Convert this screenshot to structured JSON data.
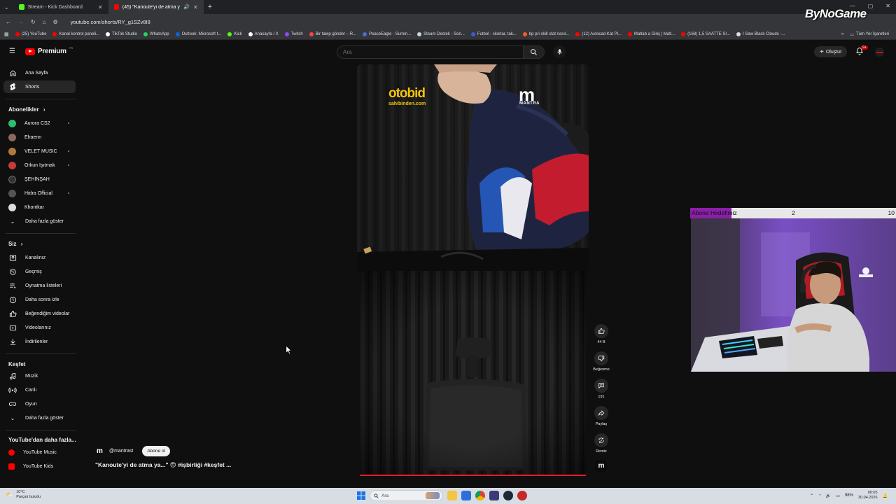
{
  "browser": {
    "tabs": [
      {
        "title": "Stream - Kick Dashboard",
        "active": false,
        "favicon_color": "#53fc18"
      },
      {
        "title": "(45) \"Kanoute'yi de atma ya...",
        "active": true,
        "favicon_color": "#ff0000"
      }
    ],
    "url": "youtube.com/shorts/RY_g1SZv8I8",
    "bookmarks": [
      {
        "label": "(25) YouTube",
        "color": "#ff0000"
      },
      {
        "label": "Kanal kontrol paneli...",
        "color": "#ff0000"
      },
      {
        "label": "TikTok Studio",
        "color": "#ffffff"
      },
      {
        "label": "WhatsApp",
        "color": "#25d366"
      },
      {
        "label": "Outlook: Microsoft t...",
        "color": "#0a64d6"
      },
      {
        "label": "Kick",
        "color": "#53fc18"
      },
      {
        "label": "Anasayfa / X",
        "color": "#ffffff"
      },
      {
        "label": "Twitch",
        "color": "#9146ff"
      },
      {
        "label": "Bir talep gönder – R...",
        "color": "#ff4444"
      },
      {
        "label": "PeaceEagle - Summ...",
        "color": "#4a6cd4"
      },
      {
        "label": "Steam Destek - Son...",
        "color": "#c7d5e0"
      },
      {
        "label": "Futbol - skorlar, tak...",
        "color": "#3a5bd9"
      },
      {
        "label": "bp pri skill stat nasıl...",
        "color": "#ff5722"
      },
      {
        "label": "(12) Autocad Kat Pl...",
        "color": "#ff0000"
      },
      {
        "label": "Matlab a Giriş | Matl...",
        "color": "#ff0000"
      },
      {
        "label": "(168) 1,5 SAATTE SI...",
        "color": "#ff0000"
      },
      {
        "label": "I Saw Black Clouds -...",
        "color": "#dddddd"
      }
    ],
    "all_bookmarks": "Tüm Yer İşaretleri"
  },
  "watermark": "ByNoGame",
  "header": {
    "logo_text": "Premium",
    "logo_sup": "TR",
    "search_placeholder": "Ara",
    "create_label": "Oluştur",
    "notif_badge": "9+"
  },
  "sidebar": {
    "main": [
      {
        "label": "Ana Sayfa",
        "icon": "home-icon"
      },
      {
        "label": "Shorts",
        "icon": "shorts-icon",
        "active": true
      }
    ],
    "subscriptions_header": "Abonelikler",
    "subscriptions": [
      {
        "label": "Aurora CS2",
        "color": "#2dbd6e",
        "dot": true
      },
      {
        "label": "Elraenn",
        "color": "#8a6a5a",
        "dot": false
      },
      {
        "label": "VELET MUSIC",
        "color": "#b07a3a",
        "dot": true
      },
      {
        "label": "Orkun Işıtmak",
        "color": "#c43c3c",
        "dot": true
      },
      {
        "label": "ŞEHİNŞAH",
        "color": "#333333",
        "dot": false
      },
      {
        "label": "Hidra Official",
        "color": "#555555",
        "dot": true
      },
      {
        "label": "Khontkar",
        "color": "#dddddd",
        "dot": false
      }
    ],
    "show_more": "Daha fazla göster",
    "you_header": "Siz",
    "you": [
      {
        "label": "Kanalınız",
        "icon": "channel-icon"
      },
      {
        "label": "Geçmiş",
        "icon": "history-icon"
      },
      {
        "label": "Oynatma listeleri",
        "icon": "playlist-icon"
      },
      {
        "label": "Daha sonra izle",
        "icon": "clock-icon"
      },
      {
        "label": "Beğendiğim videolar",
        "icon": "like-icon"
      },
      {
        "label": "Videolarınız",
        "icon": "video-icon"
      },
      {
        "label": "İndirilenler",
        "icon": "download-icon"
      }
    ],
    "explore_header": "Keşfet",
    "explore": [
      {
        "label": "Müzik",
        "icon": "music-icon"
      },
      {
        "label": "Canlı",
        "icon": "live-icon"
      },
      {
        "label": "Oyun",
        "icon": "gaming-icon"
      }
    ],
    "explore_more": "Daha fazla göster",
    "more_header": "YouTube'dan daha fazla...",
    "more": [
      {
        "label": "YouTube Music"
      },
      {
        "label": "YouTube Kids"
      }
    ]
  },
  "short": {
    "sponsor_logo": "otobid",
    "sponsor_sub": "sahibinden.com",
    "brand_logo": "m",
    "brand_text": "MANTRA",
    "channel_logo": "m",
    "channel_name": "@mantrast",
    "subscribe_label": "Abone ol",
    "title": "\"Kanoute'yi de atma ya...\" 😍 #işbirliği #keşfet ...",
    "progress": 1.0,
    "actions": {
      "likes": "44 B",
      "dislike_label": "Beğenme",
      "comments": "191",
      "share_label": "Paylaş",
      "remix_label": "Remix"
    }
  },
  "stream_overlay": {
    "goal_label": "Abone Hedefimiz",
    "current": "2",
    "target": "10",
    "fill_fraction": 0.2,
    "fill_color": "#8a1fa8"
  },
  "taskbar": {
    "weather_temp": "10°C",
    "weather_desc": "Parçalı bulutlu",
    "search_label": "Ara",
    "battery": "98%",
    "time": "00:05",
    "date": "30.04.2026"
  }
}
